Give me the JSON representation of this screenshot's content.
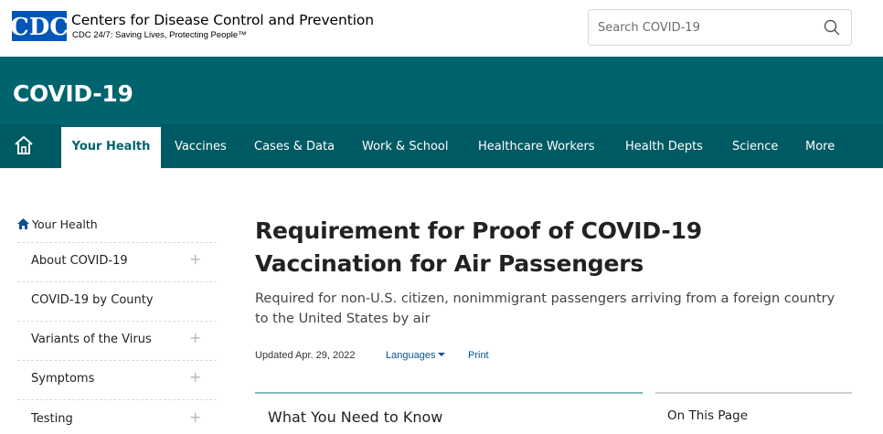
{
  "header": {
    "logo_text": "CDC",
    "org_name": "Centers for Disease Control and Prevention",
    "tagline": "CDC 24/7: Saving Lives, Protecting People™",
    "search_placeholder": "Search COVID-19",
    "brand_color": "#0057b7"
  },
  "banner": {
    "title": "COVID-19",
    "color": "#00646e"
  },
  "nav": {
    "items": [
      {
        "label": "Your Health"
      },
      {
        "label": "Vaccines"
      },
      {
        "label": "Cases & Data"
      },
      {
        "label": "Work & School"
      },
      {
        "label": "Healthcare Workers"
      },
      {
        "label": "Health Depts"
      },
      {
        "label": "Science"
      },
      {
        "label": "More"
      }
    ],
    "active": "Your Health"
  },
  "sidebar": {
    "heading": "Your Health",
    "items": [
      {
        "label": "About COVID-19",
        "expandable": true
      },
      {
        "label": "COVID-19 by County",
        "expandable": false
      },
      {
        "label": "Variants of the Virus",
        "expandable": true
      },
      {
        "label": "Symptoms",
        "expandable": true
      },
      {
        "label": "Testing",
        "expandable": true
      }
    ],
    "expand_symbol": "+"
  },
  "main": {
    "title": "Requirement for Proof of COVID-19 Vaccination for Air Passengers",
    "subtitle": "Required for non-U.S. citizen, nonimmigrant passengers arriving from a foreign country to the United States by air",
    "updated": "Updated Apr. 29, 2022",
    "languages_label": "Languages",
    "print_label": "Print",
    "card_title": "What You Need to Know",
    "on_this_page": "On This Page",
    "link_color": "#075290"
  }
}
